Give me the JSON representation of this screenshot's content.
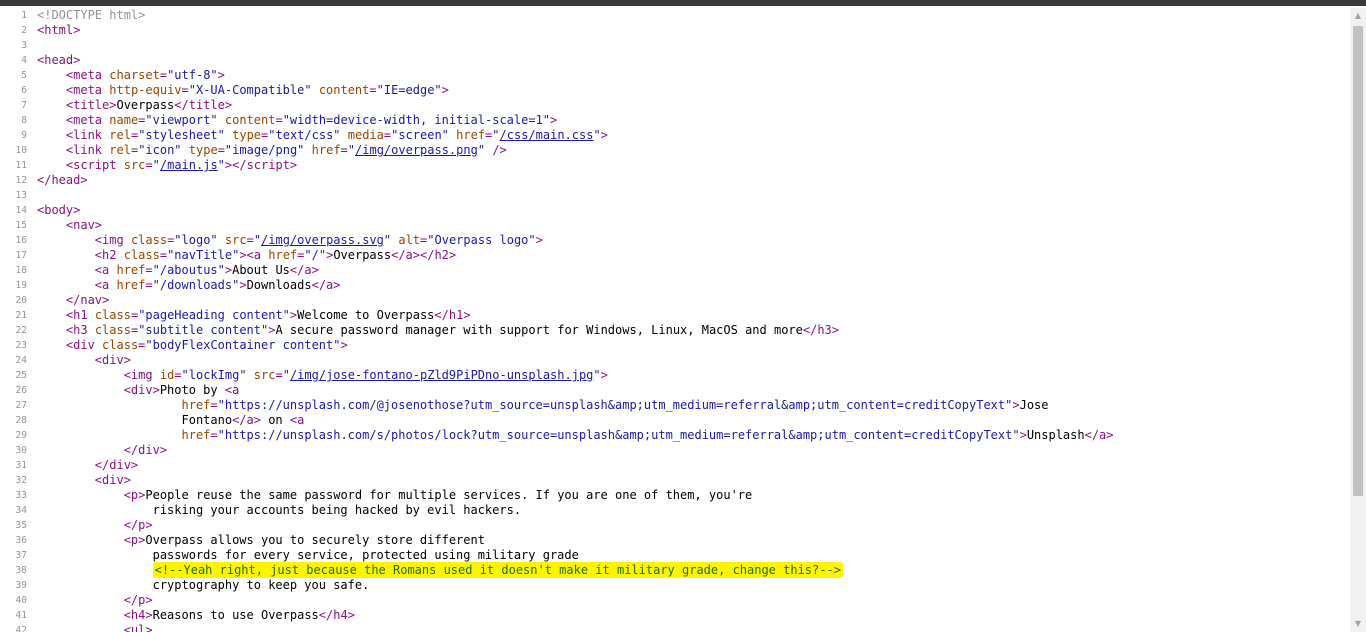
{
  "lines": [
    {
      "n": "1",
      "html": "<span class=\"doctype\">&lt;!DOCTYPE html&gt;</span>"
    },
    {
      "n": "2",
      "html": "<span class=\"tag\">&lt;html&gt;</span>"
    },
    {
      "n": "3",
      "html": ""
    },
    {
      "n": "4",
      "html": "<span class=\"tag\">&lt;head&gt;</span>"
    },
    {
      "n": "5",
      "html": "    <span class=\"tag\">&lt;meta</span> <span class=\"attr\">charset</span><span class=\"tag\">=</span><span class=\"val\">\"utf-8\"</span><span class=\"tag\">&gt;</span>"
    },
    {
      "n": "6",
      "html": "    <span class=\"tag\">&lt;meta</span> <span class=\"attr\">http-equiv</span><span class=\"tag\">=</span><span class=\"val\">\"X-UA-Compatible\"</span> <span class=\"attr\">content</span><span class=\"tag\">=</span><span class=\"val\">\"IE=edge\"</span><span class=\"tag\">&gt;</span>"
    },
    {
      "n": "7",
      "html": "    <span class=\"tag\">&lt;title&gt;</span>Overpass<span class=\"tag\">&lt;/title&gt;</span>"
    },
    {
      "n": "8",
      "html": "    <span class=\"tag\">&lt;meta</span> <span class=\"attr\">name</span><span class=\"tag\">=</span><span class=\"val\">\"viewport\"</span> <span class=\"attr\">content</span><span class=\"tag\">=</span><span class=\"val\">\"width=device-width, initial-scale=1\"</span><span class=\"tag\">&gt;</span>"
    },
    {
      "n": "9",
      "html": "    <span class=\"tag\">&lt;link</span> <span class=\"attr\">rel</span><span class=\"tag\">=</span><span class=\"val\">\"stylesheet\"</span> <span class=\"attr\">type</span><span class=\"tag\">=</span><span class=\"val\">\"text/css\"</span> <span class=\"attr\">media</span><span class=\"tag\">=</span><span class=\"val\">\"screen\"</span> <span class=\"attr\">href</span><span class=\"tag\">=</span><span class=\"val\">\"<a class=\"link\">/css/main.css</a>\"</span><span class=\"tag\">&gt;</span>"
    },
    {
      "n": "10",
      "html": "    <span class=\"tag\">&lt;link</span> <span class=\"attr\">rel</span><span class=\"tag\">=</span><span class=\"val\">\"icon\"</span> <span class=\"attr\">type</span><span class=\"tag\">=</span><span class=\"val\">\"image/png\"</span> <span class=\"attr\">href</span><span class=\"tag\">=</span><span class=\"val\">\"<a class=\"link\">/img/overpass.png</a>\"</span> <span class=\"tag\">/&gt;</span>"
    },
    {
      "n": "11",
      "html": "    <span class=\"tag\">&lt;script</span> <span class=\"attr\">src</span><span class=\"tag\">=</span><span class=\"val\">\"<a class=\"link\">/main.js</a>\"</span><span class=\"tag\">&gt;&lt;/script&gt;</span>"
    },
    {
      "n": "12",
      "html": "<span class=\"tag\">&lt;/head&gt;</span>"
    },
    {
      "n": "13",
      "html": ""
    },
    {
      "n": "14",
      "html": "<span class=\"tag\">&lt;body&gt;</span>"
    },
    {
      "n": "15",
      "html": "    <span class=\"tag\">&lt;nav&gt;</span>"
    },
    {
      "n": "16",
      "html": "        <span class=\"tag\">&lt;img</span> <span class=\"attr\">class</span><span class=\"tag\">=</span><span class=\"val\">\"logo\"</span> <span class=\"attr\">src</span><span class=\"tag\">=</span><span class=\"val\">\"<a class=\"link\">/img/overpass.svg</a>\"</span> <span class=\"attr\">alt</span><span class=\"tag\">=</span><span class=\"val\">\"Overpass logo\"</span><span class=\"tag\">&gt;</span>"
    },
    {
      "n": "17",
      "html": "        <span class=\"tag\">&lt;h2</span> <span class=\"attr\">class</span><span class=\"tag\">=</span><span class=\"val\">\"navTitle\"</span><span class=\"tag\">&gt;&lt;a</span> <span class=\"attr\">href</span><span class=\"tag\">=</span><span class=\"val\">\"/\"</span><span class=\"tag\">&gt;</span>Overpass<span class=\"tag\">&lt;/a&gt;&lt;/h2&gt;</span>"
    },
    {
      "n": "18",
      "html": "        <span class=\"tag\">&lt;a</span> <span class=\"attr\">href</span><span class=\"tag\">=</span><span class=\"val\">\"/aboutus\"</span><span class=\"tag\">&gt;</span>About Us<span class=\"tag\">&lt;/a&gt;</span>"
    },
    {
      "n": "19",
      "html": "        <span class=\"tag\">&lt;a</span> <span class=\"attr\">href</span><span class=\"tag\">=</span><span class=\"val\">\"/downloads\"</span><span class=\"tag\">&gt;</span>Downloads<span class=\"tag\">&lt;/a&gt;</span>"
    },
    {
      "n": "20",
      "html": "    <span class=\"tag\">&lt;/nav&gt;</span>"
    },
    {
      "n": "21",
      "html": "    <span class=\"tag\">&lt;h1</span> <span class=\"attr\">class</span><span class=\"tag\">=</span><span class=\"val\">\"pageHeading content\"</span><span class=\"tag\">&gt;</span>Welcome to Overpass<span class=\"tag\">&lt;/h1&gt;</span>"
    },
    {
      "n": "22",
      "html": "    <span class=\"tag\">&lt;h3</span> <span class=\"attr\">class</span><span class=\"tag\">=</span><span class=\"val\">\"subtitle content\"</span><span class=\"tag\">&gt;</span>A secure password manager with support for Windows, Linux, MacOS and more<span class=\"tag\">&lt;/h3&gt;</span>"
    },
    {
      "n": "23",
      "html": "    <span class=\"tag\">&lt;div</span> <span class=\"attr\">class</span><span class=\"tag\">=</span><span class=\"val\">\"bodyFlexContainer content\"</span><span class=\"tag\">&gt;</span>"
    },
    {
      "n": "24",
      "html": "        <span class=\"tag\">&lt;div&gt;</span>"
    },
    {
      "n": "25",
      "html": "            <span class=\"tag\">&lt;img</span> <span class=\"attr\">id</span><span class=\"tag\">=</span><span class=\"val\">\"lockImg\"</span> <span class=\"attr\">src</span><span class=\"tag\">=</span><span class=\"val\">\"<a class=\"link\">/img/jose-fontano-pZld9PiPDno-unsplash.jpg</a>\"</span><span class=\"tag\">&gt;</span>"
    },
    {
      "n": "26",
      "html": "            <span class=\"tag\">&lt;div&gt;</span>Photo by <span class=\"tag\">&lt;a</span>"
    },
    {
      "n": "27",
      "html": "                    <span class=\"attr\">href</span><span class=\"tag\">=</span><span class=\"val\">\"https://unsplash.com/@josenothose?utm_source=unsplash&amp;amp;utm_medium=referral&amp;amp;utm_content=creditCopyText\"</span><span class=\"tag\">&gt;</span>Jose"
    },
    {
      "n": "28",
      "html": "                    Fontano<span class=\"tag\">&lt;/a&gt;</span> on <span class=\"tag\">&lt;a</span>"
    },
    {
      "n": "29",
      "html": "                    <span class=\"attr\">href</span><span class=\"tag\">=</span><span class=\"val\">\"https://unsplash.com/s/photos/lock?utm_source=unsplash&amp;amp;utm_medium=referral&amp;amp;utm_content=creditCopyText\"</span><span class=\"tag\">&gt;</span>Unsplash<span class=\"tag\">&lt;/a&gt;</span>"
    },
    {
      "n": "30",
      "html": "            <span class=\"tag\">&lt;/div&gt;</span>"
    },
    {
      "n": "31",
      "html": "        <span class=\"tag\">&lt;/div&gt;</span>"
    },
    {
      "n": "32",
      "html": "        <span class=\"tag\">&lt;div&gt;</span>"
    },
    {
      "n": "33",
      "html": "            <span class=\"tag\">&lt;p&gt;</span>People reuse the same password for multiple services. If you are one of them, you're"
    },
    {
      "n": "34",
      "html": "                risking your accounts being hacked by evil hackers."
    },
    {
      "n": "35",
      "html": "            <span class=\"tag\">&lt;/p&gt;</span>"
    },
    {
      "n": "36",
      "html": "            <span class=\"tag\">&lt;p&gt;</span>Overpass allows you to securely store different"
    },
    {
      "n": "37",
      "html": "                passwords for every service, protected using military grade"
    },
    {
      "n": "38",
      "html": "                <span class=\"hl\"><span class=\"comment\">&lt;!--Yeah right, just because the Romans used it doesn't make it military grade, change this?--&gt;</span></span>"
    },
    {
      "n": "39",
      "html": "                cryptography to keep you safe."
    },
    {
      "n": "40",
      "html": "            <span class=\"tag\">&lt;/p&gt;</span>"
    },
    {
      "n": "41",
      "html": "            <span class=\"tag\">&lt;h4&gt;</span>Reasons to use Overpass<span class=\"tag\">&lt;/h4&gt;</span>"
    },
    {
      "n": "42",
      "html": "            <span class=\"tag\">&lt;ul&gt;</span>"
    }
  ]
}
